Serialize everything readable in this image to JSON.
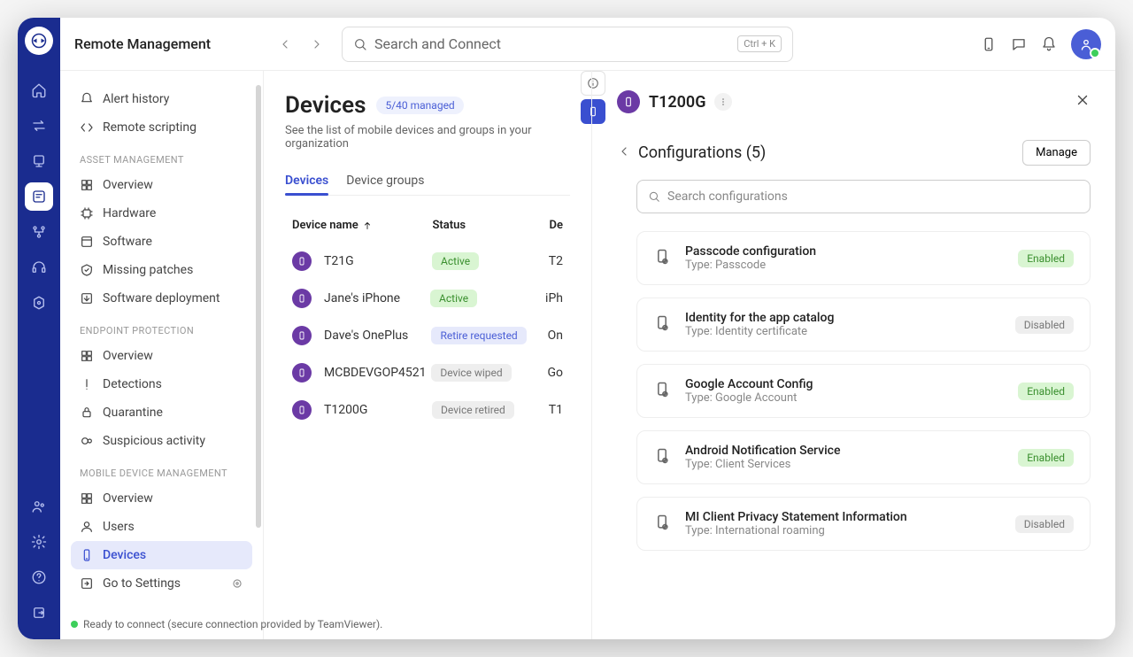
{
  "header": {
    "title": "Remote Management",
    "search_placeholder": "Search and Connect",
    "kbd": "Ctrl + K"
  },
  "sidebar": {
    "top": [
      {
        "icon": "alert-icon",
        "label": "Alert history"
      },
      {
        "icon": "script-icon",
        "label": "Remote scripting"
      }
    ],
    "sections": [
      {
        "title": "ASSET MANAGEMENT",
        "items": [
          {
            "icon": "overview-icon",
            "label": "Overview"
          },
          {
            "icon": "hardware-icon",
            "label": "Hardware"
          },
          {
            "icon": "software-icon",
            "label": "Software"
          },
          {
            "icon": "patches-icon",
            "label": "Missing patches"
          },
          {
            "icon": "deploy-icon",
            "label": "Software deployment"
          }
        ]
      },
      {
        "title": "ENDPOINT PROTECTION",
        "items": [
          {
            "icon": "overview-icon",
            "label": "Overview"
          },
          {
            "icon": "detect-icon",
            "label": "Detections"
          },
          {
            "icon": "quaran-icon",
            "label": "Quarantine"
          },
          {
            "icon": "sus-icon",
            "label": "Suspicious activity"
          }
        ]
      },
      {
        "title": "MOBILE DEVICE MANAGEMENT",
        "items": [
          {
            "icon": "overview-icon",
            "label": "Overview"
          },
          {
            "icon": "users-icon",
            "label": "Users"
          },
          {
            "icon": "devices-icon",
            "label": "Devices",
            "active": true
          },
          {
            "icon": "settings-link-icon",
            "label": "Go to Settings",
            "pin": true
          }
        ]
      }
    ]
  },
  "devices": {
    "title": "Devices",
    "managed_badge": "5/40 managed",
    "subtitle": "See the list of mobile devices and groups in your organization",
    "tabs": [
      "Devices",
      "Device groups"
    ],
    "columns": {
      "name": "Device name",
      "status": "Status",
      "device": "De"
    },
    "rows": [
      {
        "name": "T21G",
        "status": "Active",
        "status_class": "pill-active",
        "device": "T2"
      },
      {
        "name": "Jane's iPhone",
        "status": "Active",
        "status_class": "pill-active",
        "device": "iPh"
      },
      {
        "name": "Dave's OnePlus",
        "status": "Retire requested",
        "status_class": "pill-retire",
        "device": "On"
      },
      {
        "name": "MCBDEVGOP4521",
        "status": "Device wiped",
        "status_class": "pill-gray",
        "device": "Go"
      },
      {
        "name": "T1200G",
        "status": "Device retired",
        "status_class": "pill-gray",
        "device": "T1"
      }
    ]
  },
  "detail": {
    "title": "T1200G",
    "config_heading": "Configurations (5)",
    "manage_label": "Manage",
    "search_placeholder": "Search configurations",
    "configs": [
      {
        "name": "Passcode configuration",
        "type": "Type: Passcode",
        "state": "Enabled",
        "state_class": "state-enabled"
      },
      {
        "name": "Identity for the app catalog",
        "type": "Type: Identity certificate",
        "state": "Disabled",
        "state_class": "state-disabled"
      },
      {
        "name": "Google Account Config",
        "type": "Type: Google Account",
        "state": "Enabled",
        "state_class": "state-enabled"
      },
      {
        "name": "Android Notification Service",
        "type": "Type: Client Services",
        "state": "Enabled",
        "state_class": "state-enabled"
      },
      {
        "name": "MI Client Privacy Statement Information",
        "type": "Type: International roaming",
        "state": "Disabled",
        "state_class": "state-disabled"
      }
    ]
  },
  "statusbar": "Ready to connect (secure connection provided by TeamViewer)."
}
